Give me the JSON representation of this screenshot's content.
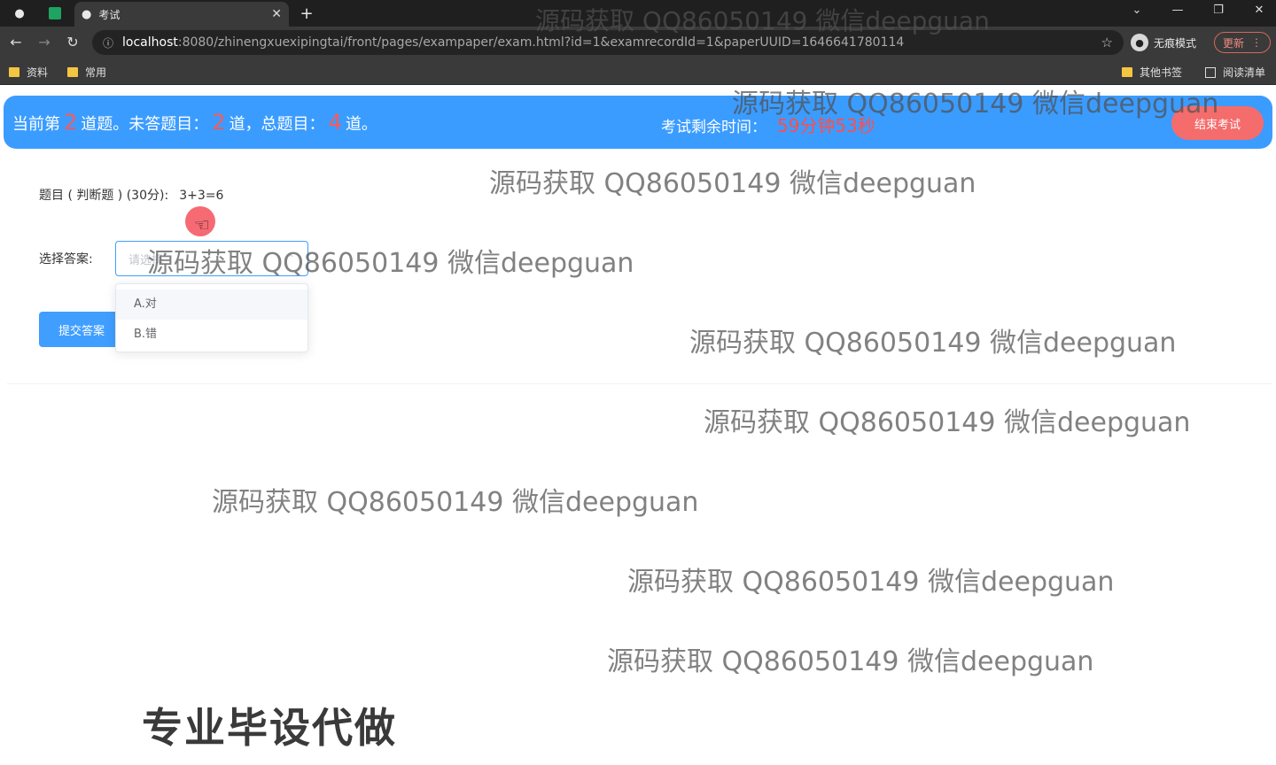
{
  "browser": {
    "tab_title": "考试",
    "url_host": "localhost",
    "url_rest": ":8080/zhinengxuexipingtai/front/pages/exampaper/exam.html?id=1&examrecordId=1&paperUUID=1646641780114",
    "incognito_label": "无痕模式",
    "update_label": "更新",
    "new_tab_symbol": "+",
    "bookmarks": [
      "资料",
      "常用"
    ],
    "bookmarks_right": [
      "其他书签",
      "阅读清单"
    ]
  },
  "status": {
    "prefix": "当前第",
    "current": "2",
    "mid1": "道题。未答题目：",
    "unanswered": "2",
    "mid2": "道，总题目：",
    "total": "4",
    "suffix": "道。",
    "timer_label": "考试剩余时间：",
    "timer_value": "59分钟53秒",
    "end_button": "结束考试"
  },
  "question": {
    "title": "题目 ( 判断题 ) (30分):",
    "text": "3+3=6",
    "answer_label": "选择答案:",
    "select_placeholder": "请选择",
    "options": [
      "A.对",
      "B.错"
    ],
    "submit_label": "提交答案"
  },
  "watermarks": [
    "源码获取 QQ86050149 微信deepguan",
    "源码获取 QQ86050149 微信deepguan",
    "源码获取 QQ86050149 微信deepguan",
    "源码获取 QQ86050149 微信deepguan",
    "源码获取 QQ86050149 微信deepguan",
    "源码获取 QQ86050149 微信deepguan",
    "源码获取 QQ86050149 微信deepguan",
    "源码获取 QQ86050149 微信deepguan",
    "源码获取 QQ86050149 微信deepguan"
  ],
  "promo_text": "专业毕设代做",
  "colors": {
    "status_bar": "#3b9cff",
    "highlight": "#ff5a5a",
    "end_button": "#f56c6c",
    "primary": "#409eff"
  }
}
